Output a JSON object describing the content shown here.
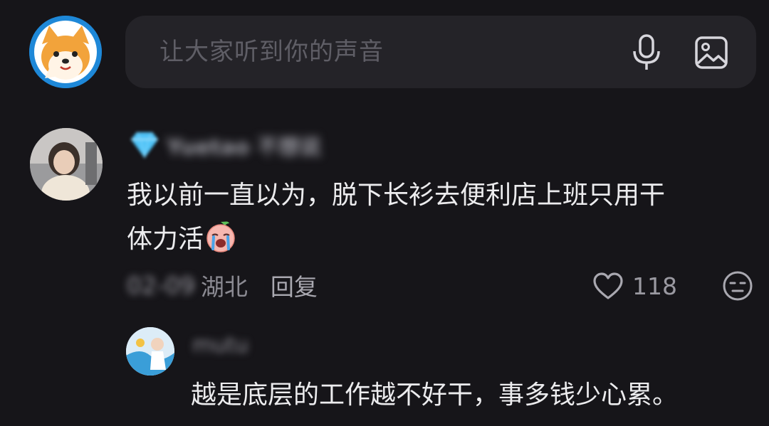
{
  "composer": {
    "placeholder": "让大家听到你的声音",
    "avatar_icon": "shiba-dog-avatar-icon",
    "mic_icon": "microphone-icon",
    "image_icon": "image-icon"
  },
  "comment": {
    "badge_icon": "diamond-icon",
    "username": "Yuetao 不想说",
    "text_line1": "我以前一直以为，脱下长衫去便利店上班只用干",
    "text_line2": "体力活",
    "emoji": "crying-face-emoji",
    "time": "02-09",
    "location": "湖北",
    "reply_label": "回复",
    "like_count": "118"
  },
  "reply": {
    "username": "mutu",
    "text": "越是底层的工作越不好干，事多钱少心累。"
  },
  "colors": {
    "background": "#161519",
    "input_bg": "#242328",
    "text_primary": "#ececee",
    "text_secondary": "#8b8a92",
    "diamond": "#4fc3f7"
  }
}
